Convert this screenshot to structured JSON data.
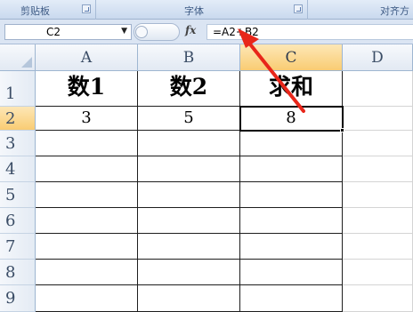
{
  "ribbon": {
    "groups": [
      {
        "label": "剪贴板"
      },
      {
        "label": "字体"
      },
      {
        "label": "对齐方"
      }
    ]
  },
  "formula_bar": {
    "name_box": "C2",
    "fx_label": "fx",
    "formula": "=A2+B2"
  },
  "sheet": {
    "columns": [
      "A",
      "B",
      "C",
      "D"
    ],
    "rows": [
      "1",
      "2",
      "3",
      "4",
      "5",
      "6",
      "7",
      "8",
      "9"
    ],
    "cells": {
      "A1": "数1",
      "B1": "数2",
      "C1": "求和",
      "A2": "3",
      "B2": "5",
      "C2": "8"
    },
    "selected_cell": "C2"
  },
  "annotation": {
    "arrow_color": "#e8261a"
  }
}
